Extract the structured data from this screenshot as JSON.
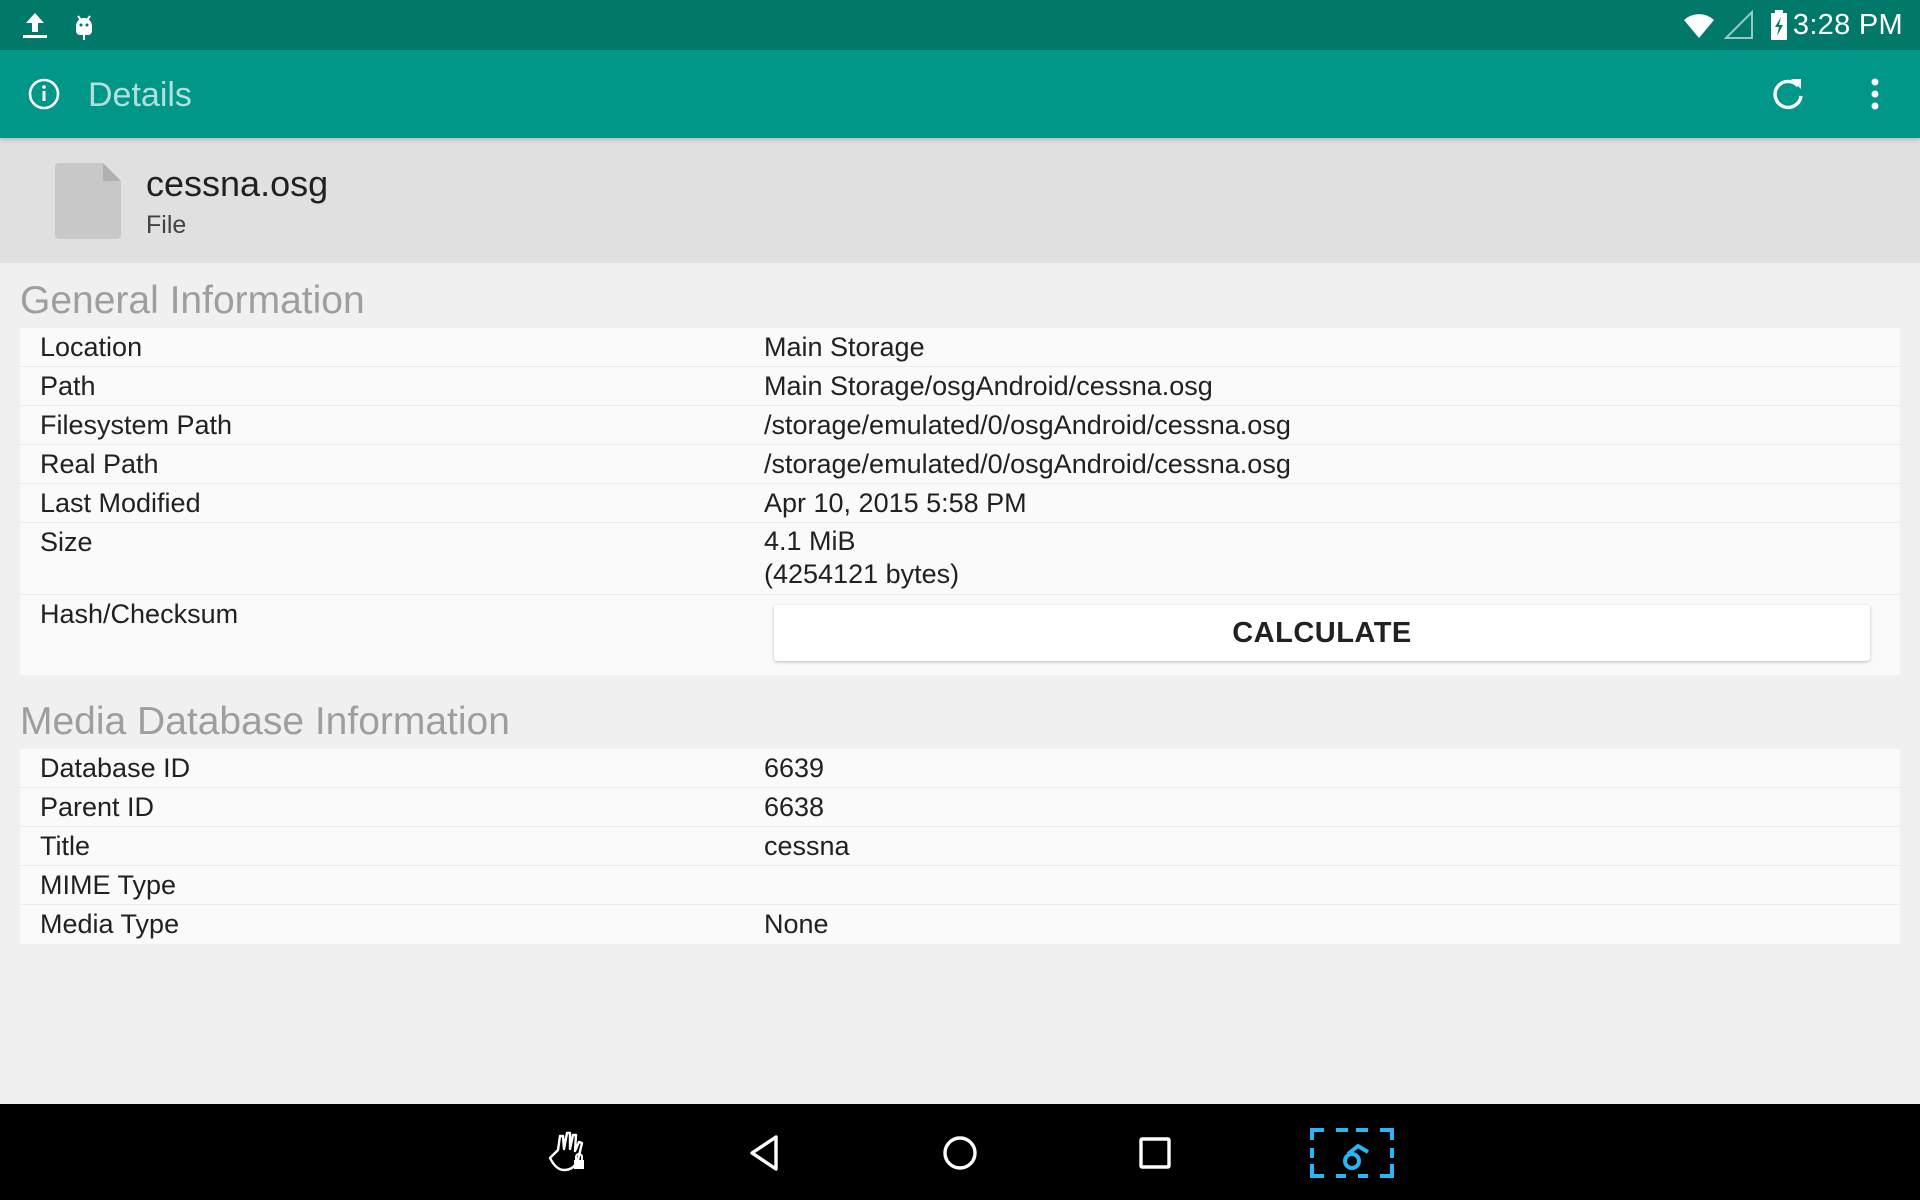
{
  "status_bar": {
    "time": "3:28 PM",
    "left_icons": [
      "upload-icon",
      "android-debug-icon"
    ],
    "right_icons": [
      "wifi-icon",
      "cell-signal-icon",
      "battery-charging-icon"
    ]
  },
  "toolbar": {
    "title": "Details",
    "icons": [
      "info-icon",
      "refresh-icon",
      "overflow-menu-icon"
    ]
  },
  "file": {
    "name": "cessna.osg",
    "type": "File",
    "icon": "file-icon"
  },
  "general": {
    "title": "General Information",
    "rows": [
      {
        "label": "Location",
        "value": "Main Storage"
      },
      {
        "label": "Path",
        "value": "Main Storage/osgAndroid/cessna.osg"
      },
      {
        "label": "Filesystem Path",
        "value": "/storage/emulated/0/osgAndroid/cessna.osg"
      },
      {
        "label": "Real Path",
        "value": "/storage/emulated/0/osgAndroid/cessna.osg"
      },
      {
        "label": "Last Modified",
        "value": "Apr 10, 2015 5:58 PM"
      },
      {
        "label": "Size",
        "value": "4.1 MiB\n(4254121 bytes)"
      },
      {
        "label": "Hash/Checksum",
        "button_label": "CALCULATE"
      }
    ]
  },
  "media": {
    "title": "Media Database Information",
    "rows": [
      {
        "label": "Database ID",
        "value": "6639"
      },
      {
        "label": "Parent ID",
        "value": "6638"
      },
      {
        "label": "Title",
        "value": "cessna"
      },
      {
        "label": "MIME Type",
        "value": ""
      },
      {
        "label": "Media Type",
        "value": "None"
      }
    ]
  },
  "nav_bar": {
    "icons": [
      "gesture-lock-icon",
      "back-icon",
      "home-icon",
      "recents-icon",
      "screenshot-capture-icon"
    ]
  },
  "colors": {
    "status_bar": "#00796b",
    "toolbar": "#009688",
    "toolbar_title": "#b2dfdb",
    "header_band": "#e0e0e0",
    "background": "#f0f0f0",
    "section_title": "#9e9e9e",
    "nav_bar": "#000000",
    "nav_accent": "#29b6f6"
  }
}
